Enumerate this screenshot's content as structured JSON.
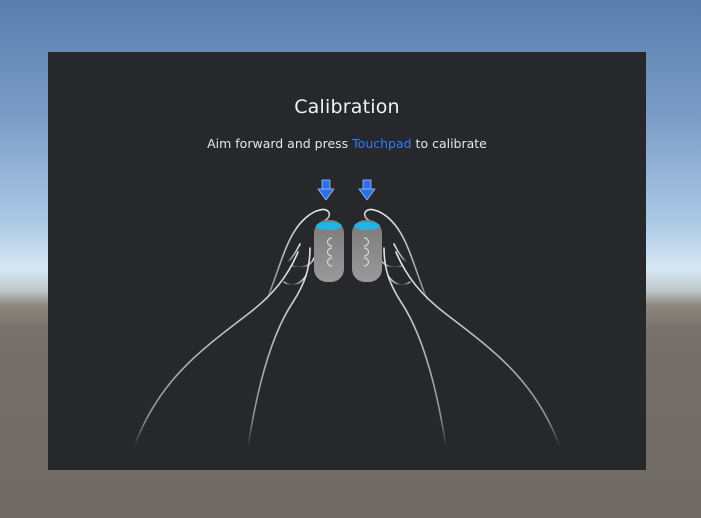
{
  "calibration": {
    "title": "Calibration",
    "instruction_before": "Aim forward and press ",
    "instruction_highlight": "Touchpad",
    "instruction_after": " to calibrate"
  },
  "colors": {
    "panel_bg": "#26282b",
    "highlight": "#2f7dff",
    "arrow": "#2f6fe6",
    "touchpad": "#1fb5e8",
    "controller": "#8c8c8c"
  },
  "icons": {
    "left_arrow": "arrow-down-icon",
    "right_arrow": "arrow-down-icon"
  }
}
